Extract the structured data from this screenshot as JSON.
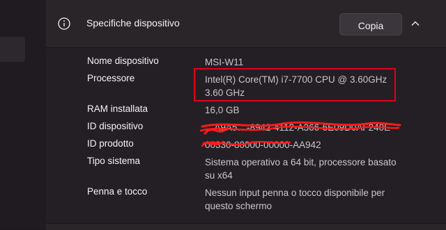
{
  "header": {
    "title": "Specifiche dispositivo",
    "copy_label": "Copia",
    "info_icon": "info-icon",
    "collapse_icon": "chevron-up-icon"
  },
  "specs": [
    {
      "label": "Nome dispositivo",
      "value": "MSI-W11"
    },
    {
      "label": "Processore",
      "value": "Intel(R) Core(TM) i7-7700 CPU @ 3.60GHz 3.60 GHz"
    },
    {
      "label": "RAM installata",
      "value": "16,0 GB"
    },
    {
      "label": "ID dispositivo",
      "value": "…A9A5…-8942-4112-A366-6E09D0AF240E"
    },
    {
      "label": "ID prodotto",
      "value": "00330-80000-00000-AA942"
    },
    {
      "label": "Tipo sistema",
      "value": "Sistema operativo a 64 bit, processore basato su x64"
    },
    {
      "label": "Penna e tocco",
      "value": "Nessun input penna o tocco disponibile per questo schermo"
    }
  ],
  "colors": {
    "highlight": "#e3001b",
    "redaction": "#ff1a1a"
  }
}
